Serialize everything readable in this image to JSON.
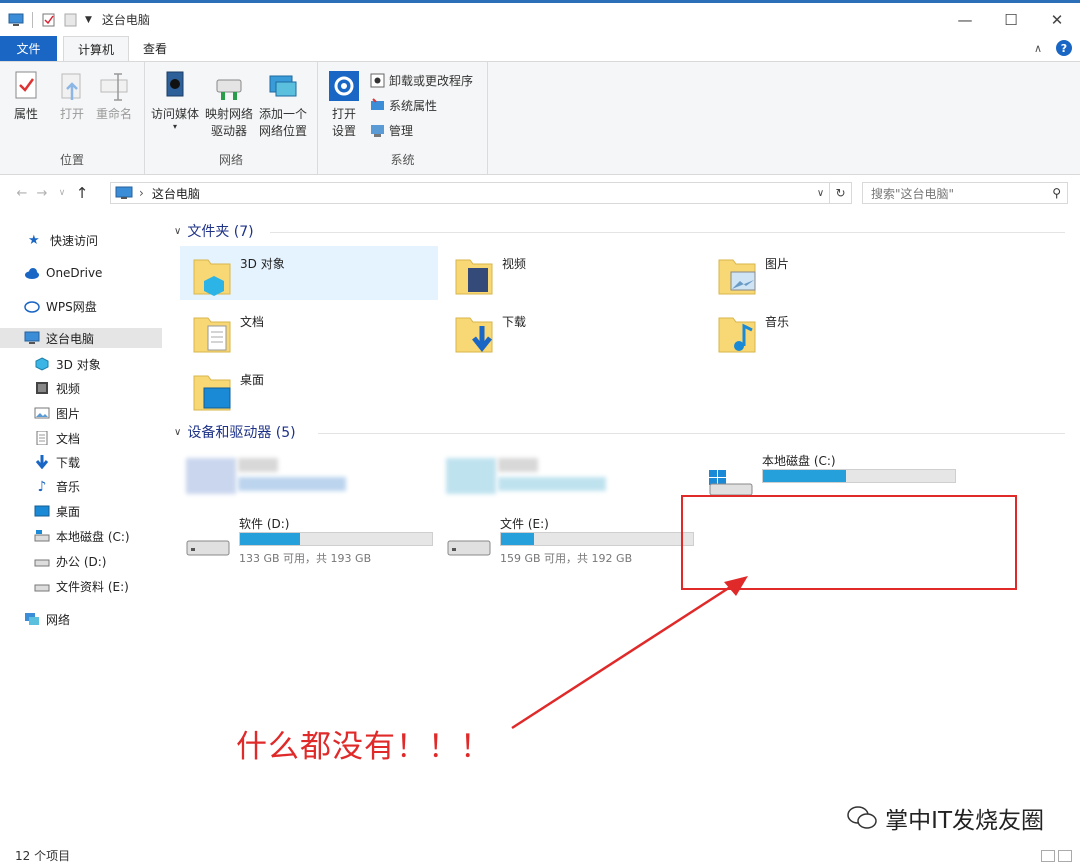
{
  "window": {
    "title": "这台电脑",
    "controls": [
      "minimize-icon",
      "maximize-icon",
      "close-icon"
    ]
  },
  "ribbon": {
    "tabs": [
      {
        "label": "文件"
      },
      {
        "label": "计算机"
      },
      {
        "label": "查看"
      }
    ],
    "groups": [
      {
        "label": "位置",
        "buttons": [
          "属性",
          "打开",
          "重命名"
        ]
      },
      {
        "label": "网络",
        "buttons": [
          "访问媒体",
          "映射网络",
          "驱动器",
          "添加一个",
          "网络位置"
        ]
      },
      {
        "label": "系统",
        "buttons": [
          "打开",
          "设置",
          "卸载或更改程序",
          "系统属性",
          "管理"
        ]
      }
    ]
  },
  "address": {
    "path": "这台电脑",
    "search_placeholder": "搜索\"这台电脑\""
  },
  "sidebar": {
    "items": [
      {
        "label": "快速访问"
      },
      {
        "label": "OneDrive"
      },
      {
        "label": "WPS网盘"
      },
      {
        "label": "这台电脑"
      },
      {
        "label": "3D 对象"
      },
      {
        "label": "视频"
      },
      {
        "label": "图片"
      },
      {
        "label": "文档"
      },
      {
        "label": "下载"
      },
      {
        "label": "音乐"
      },
      {
        "label": "桌面"
      },
      {
        "label": "本地磁盘 (C:)"
      },
      {
        "label": "办公 (D:)"
      },
      {
        "label": "文件资料 (E:)"
      },
      {
        "label": "网络"
      }
    ]
  },
  "folders_section": {
    "title": "文件夹 (7)",
    "items": [
      {
        "name": "3D 对象"
      },
      {
        "name": "视频"
      },
      {
        "name": "图片"
      },
      {
        "name": "文档"
      },
      {
        "name": "下载"
      },
      {
        "name": "音乐"
      },
      {
        "name": "桌面"
      }
    ]
  },
  "devices_section": {
    "title": "设备和驱动器 (5)",
    "drives": [
      {
        "name": "本地磁盘 (C:)",
        "usage_fraction": 0.43
      },
      {
        "name": "软件 (D:)",
        "free": "133 GB 可用，共 193 GB",
        "usage_fraction": 0.31
      },
      {
        "name": "文件 (E:)",
        "free": "159 GB 可用，共 192 GB",
        "usage_fraction": 0.17
      }
    ]
  },
  "annotation": {
    "text": "什么都没有！！！",
    "color": "#e02a2a"
  },
  "status_bar": {
    "count": "12 个项目"
  },
  "watermark": {
    "text": "掌中IT发烧友圈"
  },
  "colors": {
    "accent": "#1a66c4",
    "selection": "#cce8ff",
    "progress": "#26a0da"
  }
}
